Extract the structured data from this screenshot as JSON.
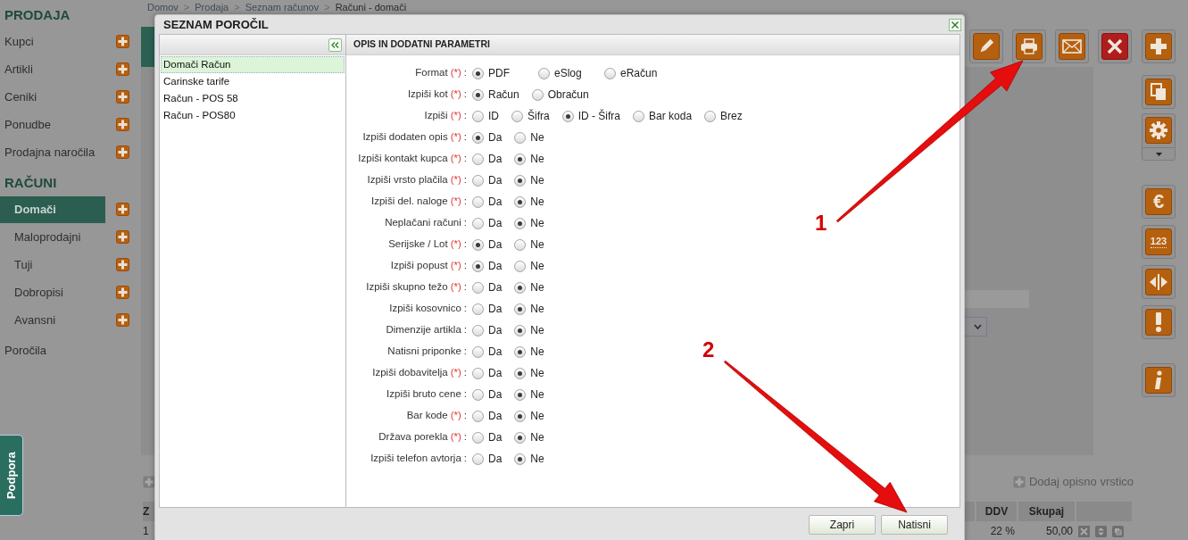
{
  "breadcrumb": [
    {
      "kind": "link",
      "label": "Domov"
    },
    {
      "kind": "separator",
      "label": ">"
    },
    {
      "kind": "link",
      "label": "Prodaja"
    },
    {
      "kind": "separator",
      "label": ">"
    },
    {
      "kind": "link",
      "label": "Seznam računov"
    },
    {
      "kind": "separator",
      "label": ">"
    },
    {
      "kind": "current",
      "label": "Računi - domači"
    }
  ],
  "sidebar": {
    "sections": [
      {
        "title": "PRODAJA",
        "items": [
          {
            "label": "Kupci",
            "selected": false
          },
          {
            "label": "Artikli",
            "selected": false
          },
          {
            "label": "Ceniki",
            "selected": false
          },
          {
            "label": "Ponudbe",
            "selected": false
          },
          {
            "label": "Prodajna naročila",
            "selected": false
          }
        ]
      },
      {
        "title": "RAČUNI",
        "items": [
          {
            "label": "Domači",
            "selected": true
          },
          {
            "label": "Maloprodajni",
            "selected": false
          },
          {
            "label": "Tuji",
            "selected": false
          },
          {
            "label": "Dobropisi",
            "selected": false
          },
          {
            "label": "Avansni",
            "selected": false
          }
        ]
      }
    ],
    "link": "Poročila"
  },
  "support_tab": "Podpora",
  "toolbar": [
    {
      "kind": "edit"
    },
    {
      "kind": "print"
    },
    {
      "kind": "email"
    },
    {
      "kind": "delete"
    }
  ],
  "side_buttons": [
    {
      "kind": "add"
    },
    {
      "kind": "copy"
    },
    {
      "kind": "settings"
    },
    {
      "kind": "currency",
      "label": "€"
    },
    {
      "kind": "numbering",
      "label": "123"
    },
    {
      "kind": "split"
    },
    {
      "kind": "warning"
    },
    {
      "kind": "info"
    }
  ],
  "add_line": "Dodaj opisno vrstico",
  "table": {
    "columns": [
      "Z",
      "DDV",
      "Skupaj"
    ],
    "rows": [
      [
        "1",
        "22 %",
        "50,00"
      ]
    ]
  },
  "modal": {
    "title": "SEZNAM POROČIL",
    "reports": [
      {
        "label": "Domači Račun",
        "selected": true
      },
      {
        "label": "Carinske tarife",
        "selected": false
      },
      {
        "label": "Račun - POS 58",
        "selected": false
      },
      {
        "label": "Račun - POS80",
        "selected": false
      }
    ],
    "panel_title": "OPIS IN DODATNI PARAMETRI",
    "fields": [
      {
        "label": "Format",
        "required_mark": "(*)",
        "colon": ":",
        "options": [
          {
            "label": "PDF",
            "selected": true
          },
          {
            "label": "eSlog",
            "selected": false
          },
          {
            "label": "eRačun",
            "selected": false
          }
        ]
      },
      {
        "label": "Izpiši kot",
        "required_mark": "(*)",
        "colon": ":",
        "options": [
          {
            "label": "Račun",
            "selected": true
          },
          {
            "label": "Obračun",
            "selected": false
          }
        ]
      },
      {
        "label": "Izpiši",
        "required_mark": "(*)",
        "colon": ":",
        "options": [
          {
            "label": "ID",
            "selected": false
          },
          {
            "label": "Šifra",
            "selected": false
          },
          {
            "label": "ID - Šifra",
            "selected": true
          },
          {
            "label": "Bar koda",
            "selected": false
          },
          {
            "label": "Brez",
            "selected": false
          }
        ]
      },
      {
        "label": "Izpiši dodaten opis",
        "required_mark": "(*)",
        "colon": ":",
        "options": [
          {
            "label": "Da",
            "selected": true
          },
          {
            "label": "Ne",
            "selected": false
          }
        ]
      },
      {
        "label": "Izpiši kontakt kupca",
        "required_mark": "(*)",
        "colon": ":",
        "options": [
          {
            "label": "Da",
            "selected": false
          },
          {
            "label": "Ne",
            "selected": true
          }
        ]
      },
      {
        "label": "Izpiši vrsto plačila",
        "required_mark": "(*)",
        "colon": ":",
        "options": [
          {
            "label": "Da",
            "selected": false
          },
          {
            "label": "Ne",
            "selected": true
          }
        ]
      },
      {
        "label": "Izpiši del. naloge",
        "required_mark": "(*)",
        "colon": ":",
        "options": [
          {
            "label": "Da",
            "selected": false
          },
          {
            "label": "Ne",
            "selected": true
          }
        ]
      },
      {
        "label": "Neplačani računi",
        "colon": ":",
        "options": [
          {
            "label": "Da",
            "selected": false
          },
          {
            "label": "Ne",
            "selected": true
          }
        ]
      },
      {
        "label": "Serijske / Lot",
        "required_mark": "(*)",
        "colon": ":",
        "options": [
          {
            "label": "Da",
            "selected": true
          },
          {
            "label": "Ne",
            "selected": false
          }
        ]
      },
      {
        "label": "Izpiši popust",
        "required_mark": "(*)",
        "colon": ":",
        "options": [
          {
            "label": "Da",
            "selected": true
          },
          {
            "label": "Ne",
            "selected": false
          }
        ]
      },
      {
        "label": "Izpiši skupno težo",
        "required_mark": "(*)",
        "colon": ":",
        "options": [
          {
            "label": "Da",
            "selected": false
          },
          {
            "label": "Ne",
            "selected": true
          }
        ]
      },
      {
        "label": "Izpiši kosovnico",
        "colon": ":",
        "options": [
          {
            "label": "Da",
            "selected": false
          },
          {
            "label": "Ne",
            "selected": true
          }
        ]
      },
      {
        "label": "Dimenzije artikla",
        "colon": ":",
        "options": [
          {
            "label": "Da",
            "selected": false
          },
          {
            "label": "Ne",
            "selected": true
          }
        ]
      },
      {
        "label": "Natisni priponke",
        "colon": ":",
        "options": [
          {
            "label": "Da",
            "selected": false
          },
          {
            "label": "Ne",
            "selected": true
          }
        ]
      },
      {
        "label": "Izpiši dobavitelja",
        "required_mark": "(*)",
        "colon": ":",
        "options": [
          {
            "label": "Da",
            "selected": false
          },
          {
            "label": "Ne",
            "selected": true
          }
        ]
      },
      {
        "label": "Izpiši bruto cene",
        "colon": ":",
        "options": [
          {
            "label": "Da",
            "selected": false
          },
          {
            "label": "Ne",
            "selected": true
          }
        ]
      },
      {
        "label": "Bar kode",
        "required_mark": "(*)",
        "colon": ":",
        "options": [
          {
            "label": "Da",
            "selected": false
          },
          {
            "label": "Ne",
            "selected": true
          }
        ]
      },
      {
        "label": "Država porekla",
        "required_mark": "(*)",
        "colon": ":",
        "options": [
          {
            "label": "Da",
            "selected": false
          },
          {
            "label": "Ne",
            "selected": true
          }
        ]
      },
      {
        "label": "Izpiši telefon avtorja",
        "colon": ":",
        "options": [
          {
            "label": "Da",
            "selected": false
          },
          {
            "label": "Ne",
            "selected": true
          }
        ]
      }
    ],
    "buttons": [
      "Zapri",
      "Natisni"
    ]
  },
  "annotations": [
    {
      "label": "1"
    },
    {
      "label": "2"
    }
  ]
}
